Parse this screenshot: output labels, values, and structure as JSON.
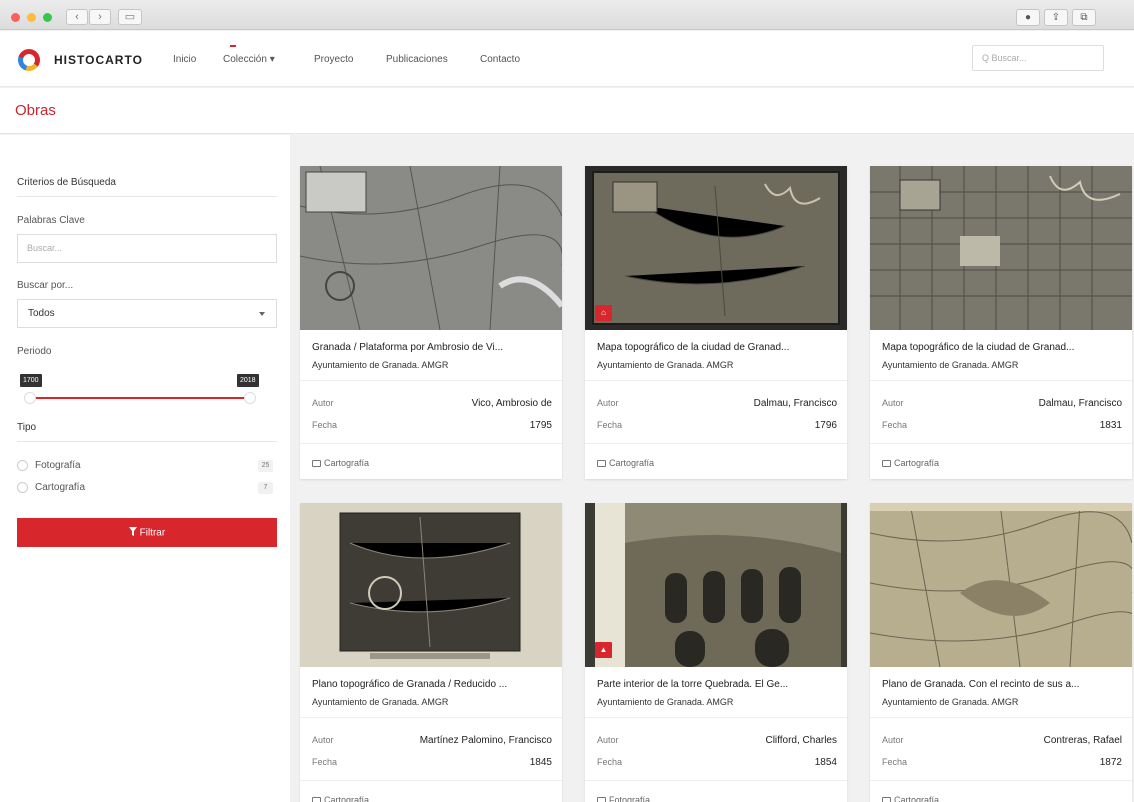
{
  "browser": {
    "back": "‹",
    "forward": "›",
    "sidebar_icon": "▭",
    "toolbar": [
      "●",
      "⇪",
      "⧉"
    ]
  },
  "brand": {
    "name": "HISTOCARTO",
    "logo_icon": "logo-icon"
  },
  "nav": {
    "items": [
      "Inicio",
      "Colección ▾",
      "Proyecto",
      "Publicaciones",
      "Contacto"
    ],
    "search_placeholder": "Q  Buscar..."
  },
  "page": {
    "title": "Obras"
  },
  "sidebar": {
    "criteria_title": "Criterios de Búsqueda",
    "keywords_label": "Palabras Clave",
    "keywords_placeholder": "Buscar...",
    "searchby_label": "Buscar por...",
    "searchby_value": "Todos",
    "period_label": "Periodo",
    "period_min": "1700",
    "period_max": "2018",
    "type_label": "Tipo",
    "types": [
      {
        "label": "Fotografía",
        "count": "25"
      },
      {
        "label": "Cartografía",
        "count": "7"
      }
    ],
    "filter_label": "Filtrar",
    "filter_icon": "funnel-icon"
  },
  "cards": [
    {
      "title": "Granada / Plataforma por Ambrosio de Vi...",
      "owner": "Ayuntamiento de Granada. AMGR",
      "author_key": "Autor",
      "author": "Vico, Ambrosio de",
      "date_key": "Fecha",
      "date": "1795",
      "type": "Cartografía",
      "badge": ""
    },
    {
      "title": "Mapa topográfico de la ciudad de Granad...",
      "owner": "Ayuntamiento de Granada. AMGR",
      "author_key": "Autor",
      "author": "Dalmau, Francisco",
      "date_key": "Fecha",
      "date": "1796",
      "type": "Cartografía",
      "badge": "⌂"
    },
    {
      "title": "Mapa topográfico de la ciudad de Granad...",
      "owner": "Ayuntamiento de Granada. AMGR",
      "author_key": "Autor",
      "author": "Dalmau, Francisco",
      "date_key": "Fecha",
      "date": "1831",
      "type": "Cartografía",
      "badge": ""
    },
    {
      "title": "Plano topográfico de Granada / Reducido ...",
      "owner": "Ayuntamiento de Granada. AMGR",
      "author_key": "Autor",
      "author": "Martínez Palomino, Francisco",
      "date_key": "Fecha",
      "date": "1845",
      "type": "Cartografía",
      "badge": ""
    },
    {
      "title": "Parte interior de la torre Quebrada. El Ge...",
      "owner": "Ayuntamiento de Granada. AMGR",
      "author_key": "Autor",
      "author": "Clifford, Charles",
      "date_key": "Fecha",
      "date": "1854",
      "type": "Fotografía",
      "badge": "▲"
    },
    {
      "title": "Plano de Granada. Con el recinto de sus a...",
      "owner": "Ayuntamiento de Granada. AMGR",
      "author_key": "Autor",
      "author": "Contreras, Rafael",
      "date_key": "Fecha",
      "date": "1872",
      "type": "Cartografía",
      "badge": ""
    }
  ],
  "colors": {
    "accent": "#d7262c",
    "page_bg": "#f1f1f1"
  }
}
